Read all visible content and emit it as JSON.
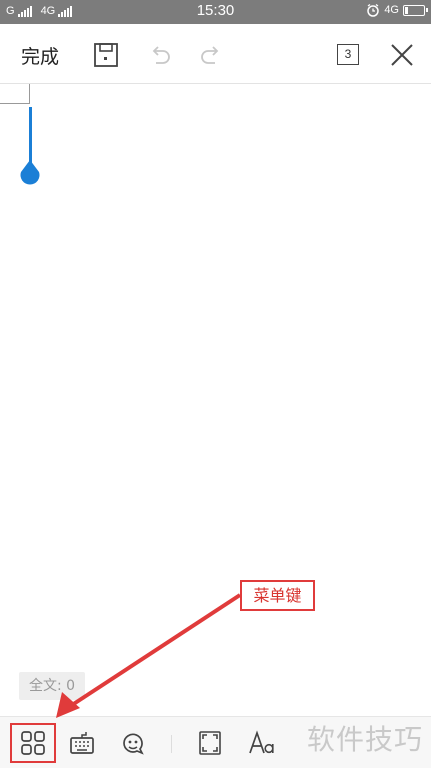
{
  "status_bar": {
    "sim1_label": "G",
    "sim2_label": "4G",
    "time": "15:30",
    "network_label": "4G"
  },
  "toolbar": {
    "done_label": "完成",
    "page_count": "3"
  },
  "editor": {
    "word_count_label": "全文: 0"
  },
  "annotation": {
    "label": "菜单键",
    "color": "#e03b3b"
  },
  "watermark": "软件技巧",
  "colors": {
    "accent": "#1b7fd6",
    "status_bar_bg": "#7c7c7c"
  },
  "icons": {
    "toolbar": [
      "save-icon",
      "undo-icon",
      "redo-icon",
      "page-count-icon",
      "close-icon"
    ],
    "bottom_bar": [
      "menu-icon",
      "keyboard-icon",
      "voice-input-icon",
      "fullscreen-icon",
      "font-style-icon"
    ]
  }
}
